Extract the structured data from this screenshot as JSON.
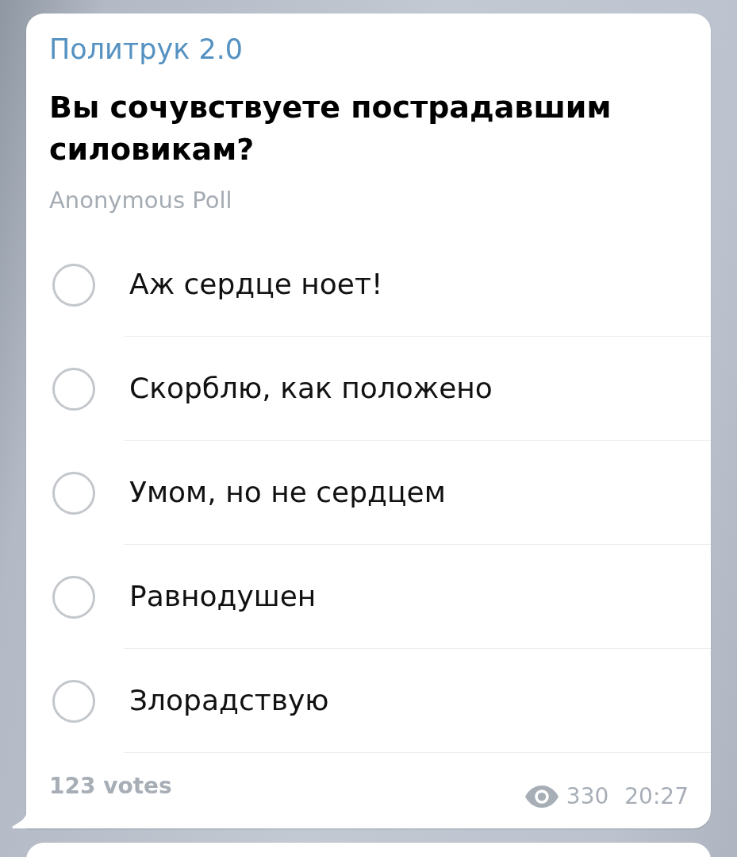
{
  "message": {
    "author": "Политрук 2.0",
    "question": "Вы сочувствуете пострадавшим силовикам?",
    "poll_type": "Anonymous Poll",
    "options": [
      {
        "text": "Аж сердце ноет!",
        "selected": false
      },
      {
        "text": "Скорблю, как положено",
        "selected": false
      },
      {
        "text": "Умом, но не сердцем",
        "selected": false
      },
      {
        "text": "Равнодушен",
        "selected": false
      },
      {
        "text": "Злорадствую",
        "selected": false
      }
    ],
    "votes": "123 votes",
    "views": "330",
    "time": "20:27"
  }
}
